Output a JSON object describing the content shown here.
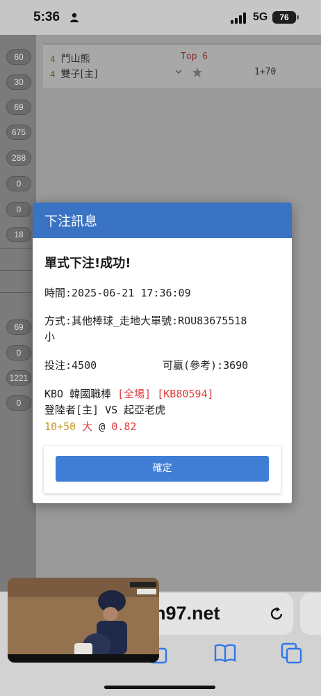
{
  "status_bar": {
    "time": "5:36",
    "network": "5G",
    "battery": "76"
  },
  "background": {
    "side_numbers": [
      "60",
      "30",
      "69",
      "675",
      "288",
      "0",
      "0",
      "18",
      "69",
      "0",
      "1221",
      "0"
    ],
    "rows": [
      {
        "num": "4",
        "team": "鬥山熊",
        "info": "Top 6"
      },
      {
        "num": "4",
        "team": "雙子[主]",
        "odds": "1+70"
      }
    ]
  },
  "modal": {
    "header": "下注訊息",
    "title": "單式下注!成功!",
    "time": "時間:2025-06-21 17:36:09",
    "method_line1": "方式:其他棒球_走地大單號:ROU83675518",
    "method_line2": "小",
    "stake": "投注:4500",
    "win": "可贏(參考):3690",
    "league": "KBO 韓國職棒",
    "scope": "[全場]",
    "code": "[KB80594]",
    "teams": "登陸者[主] VS 起亞老虎",
    "handicap": "10+50",
    "side": "大",
    "at": "@",
    "odds": "0.82",
    "confirm_label": "確定"
  },
  "safari": {
    "url": "n97.net"
  },
  "colors": {
    "header": "#3a72c4",
    "button": "#3f7ed4",
    "red": "#e23a3a",
    "gold": "#c79a2a"
  }
}
